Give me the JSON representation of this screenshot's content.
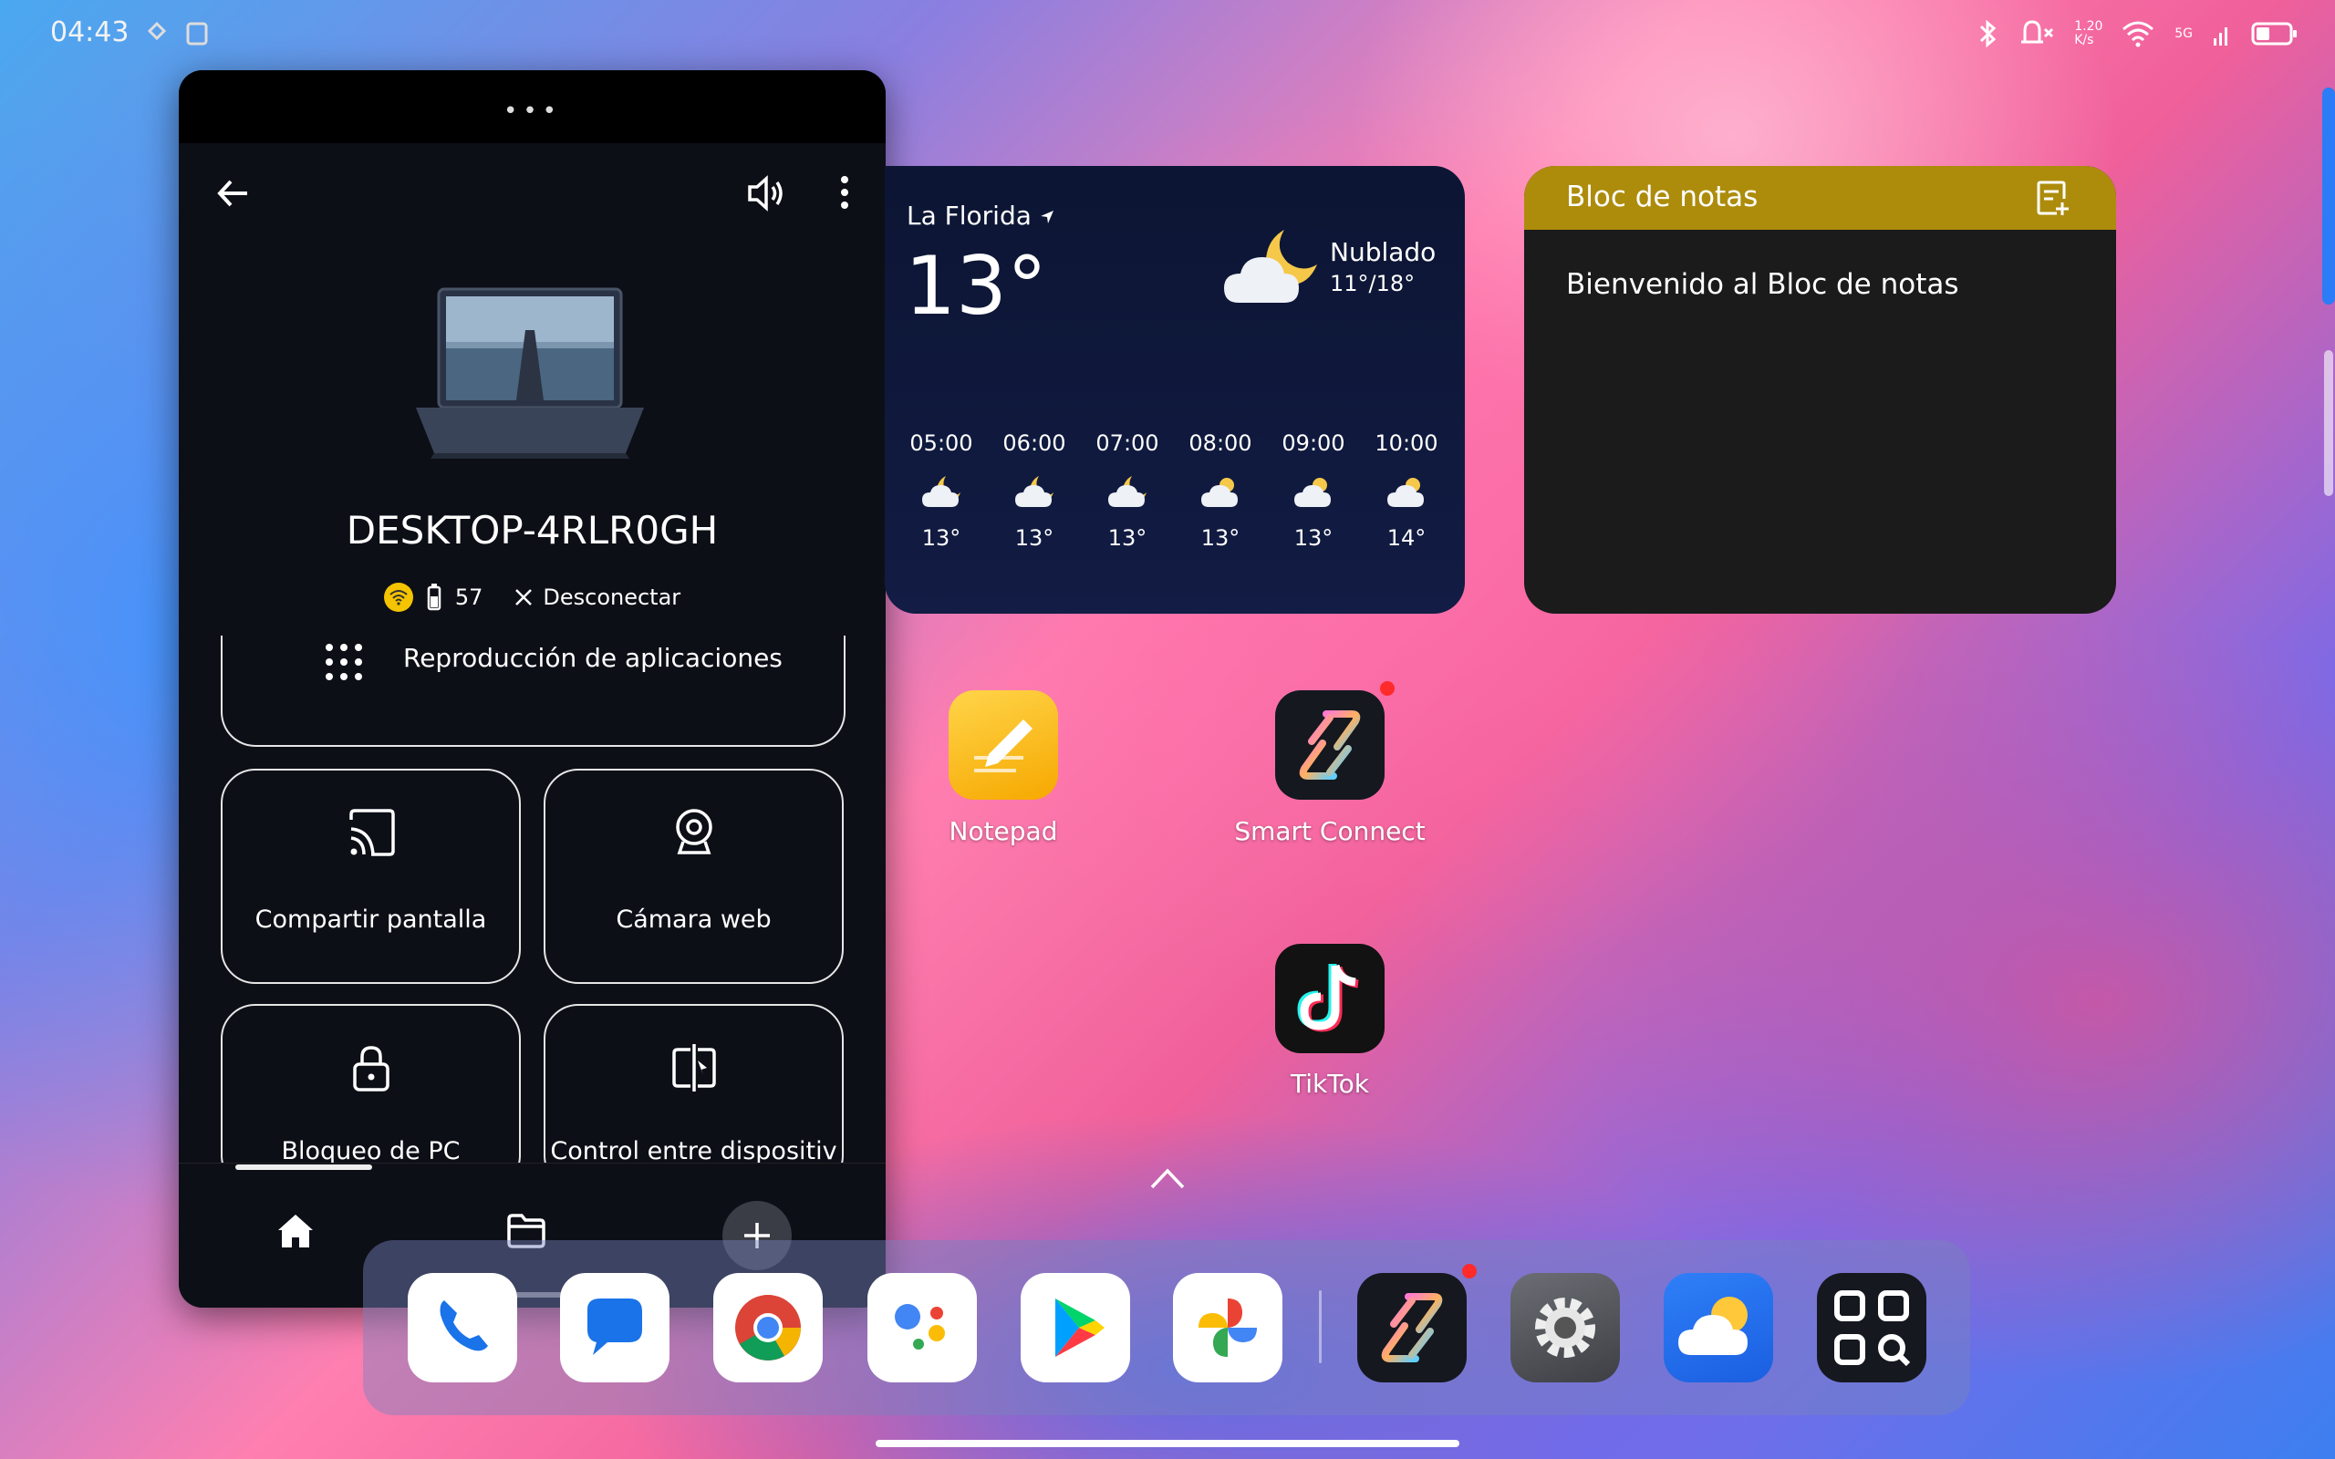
{
  "status_bar": {
    "time": "04:43",
    "speed": "1.20 K/s",
    "network": "5G"
  },
  "smart_connect_panel": {
    "device_name": "DESKTOP-4RLR0GH",
    "battery": "57",
    "disconnect_label": "Desconectar",
    "app_playback_label": "Reproducción de aplicaciones",
    "tiles": [
      {
        "label": "Compartir pantalla",
        "icon": "cast-icon"
      },
      {
        "label": "Cámara web",
        "icon": "webcam-icon"
      },
      {
        "label": "Bloqueo de PC",
        "icon": "lock-icon"
      },
      {
        "label": "Control entre dispositiv",
        "icon": "cross-device-icon"
      }
    ]
  },
  "weather": {
    "location": "La Florida",
    "temperature": "13°",
    "condition": "Nublado",
    "range": "11°/18°",
    "hours": [
      {
        "time": "05:00",
        "temp": "13°"
      },
      {
        "time": "06:00",
        "temp": "13°"
      },
      {
        "time": "07:00",
        "temp": "13°"
      },
      {
        "time": "08:00",
        "temp": "13°"
      },
      {
        "time": "09:00",
        "temp": "13°"
      },
      {
        "time": "10:00",
        "temp": "14°"
      }
    ]
  },
  "notes": {
    "title": "Bloc de notas",
    "body": "Bienvenido al Bloc de notas"
  },
  "apps": {
    "notepad": "Notepad",
    "smart_connect": "Smart Connect",
    "tiktok": "TikTok"
  },
  "colors": {
    "notes_header": "#ad8c0c",
    "accent_blue": "#2b7cf6",
    "panel_bg": "#0d0f17"
  }
}
